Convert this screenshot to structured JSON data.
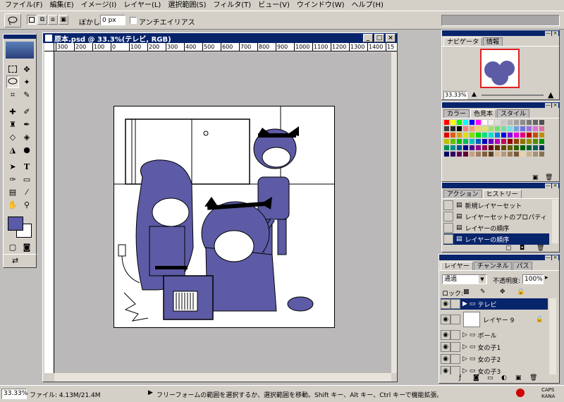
{
  "menu": [
    "ファイル(F)",
    "編集(E)",
    "イメージ(I)",
    "レイヤー(L)",
    "選択範囲(S)",
    "フィルタ(T)",
    "ビュー(V)",
    "ウインドウ(W)",
    "ヘルプ(H)"
  ],
  "options": {
    "feather_label": "ぼかし:",
    "feather_value": "0 px",
    "antialias_label": "アンチエイリアス"
  },
  "document": {
    "title": "原本.psd @ 33.3%(テレビ, RGB)",
    "ruler_ticks": [
      "300",
      "200",
      "100",
      "0",
      "100",
      "200",
      "300",
      "400",
      "500",
      "600",
      "700",
      "800",
      "900",
      "1000",
      "1100",
      "1200",
      "1300",
      "1400",
      "15"
    ]
  },
  "status": {
    "zoom": "33.33%",
    "file_info": "ファイル: 4.13M/21.4M",
    "hint": "フリーフォームの範囲を選択するか、選択範囲を移動。Shift キー、Alt キー、Ctrl キーで機能拡張。",
    "caps": "CAPS",
    "kana": "KANA"
  },
  "navigator": {
    "tabs": [
      "ナビゲータ",
      "情報"
    ],
    "zoom": "33.33%"
  },
  "swatches": {
    "tabs": [
      "カラー",
      "色見本",
      "スタイル"
    ],
    "colors": [
      "#ff0000",
      "#ffff00",
      "#00ff00",
      "#00ffff",
      "#0000ff",
      "#ff00ff",
      "#ffffff",
      "#f0f0f0",
      "#dcdcdc",
      "#c8c8c8",
      "#b4b4b4",
      "#a0a0a0",
      "#8c8c8c",
      "#787878",
      "#646464",
      "#505050",
      "#3c3c3c",
      "#282828",
      "#000000",
      "#f08080",
      "#f0a070",
      "#f0d070",
      "#e0e070",
      "#a0e070",
      "#70e070",
      "#70e0a0",
      "#70e0e0",
      "#70a0e0",
      "#7070e0",
      "#a070e0",
      "#e070e0",
      "#e070a0",
      "#e00000",
      "#e06000",
      "#e0a000",
      "#e0e000",
      "#80e000",
      "#00e000",
      "#00e080",
      "#00e0e0",
      "#0080e0",
      "#0000e0",
      "#8000e0",
      "#e000e0",
      "#e00080",
      "#c00000",
      "#c05000",
      "#c09000",
      "#c0c000",
      "#60c000",
      "#00c000",
      "#00c060",
      "#00c0c0",
      "#0060c0",
      "#0000c0",
      "#6000c0",
      "#c000c0",
      "#c00060",
      "#900000",
      "#904000",
      "#907000",
      "#909000",
      "#509000",
      "#009000",
      "#009050",
      "#009090",
      "#005090",
      "#000090",
      "#500090",
      "#900090",
      "#900050",
      "#600000",
      "#603000",
      "#604800",
      "#606000",
      "#306000",
      "#006000",
      "#006030",
      "#006060",
      "#003060",
      "#000060",
      "#300060",
      "#600060",
      "#600030",
      "#c8a080",
      "#a08060",
      "#806040",
      "#604020",
      "#d8b898",
      "#b89878",
      "#987858",
      "#785838",
      "#e8d0b0",
      "#c8b090",
      "#a89070",
      "#887050"
    ]
  },
  "history": {
    "tabs": [
      "アクション",
      "ヒストリー"
    ],
    "items": [
      "新規レイヤーセット",
      "レイヤーセットのプロパティ",
      "レイヤーの順序",
      "レイヤーの順序"
    ],
    "selected_index": 3
  },
  "layers": {
    "tabs": [
      "レイヤー",
      "チャンネル",
      "パス"
    ],
    "blend_mode": "通過",
    "opacity_label": "不透明度:",
    "opacity_value": "100%",
    "lock_label": "ロック:",
    "items": [
      "テレビ",
      "レイヤー 9",
      "ボール",
      "女の子1",
      "女の子2",
      "女の子3"
    ],
    "selected_index": 0
  },
  "colors": {
    "foreground": "#5a5aa8",
    "background": "#ffffff",
    "titlebar": "#08246b",
    "lineart_fill": "#5d5ba5"
  }
}
